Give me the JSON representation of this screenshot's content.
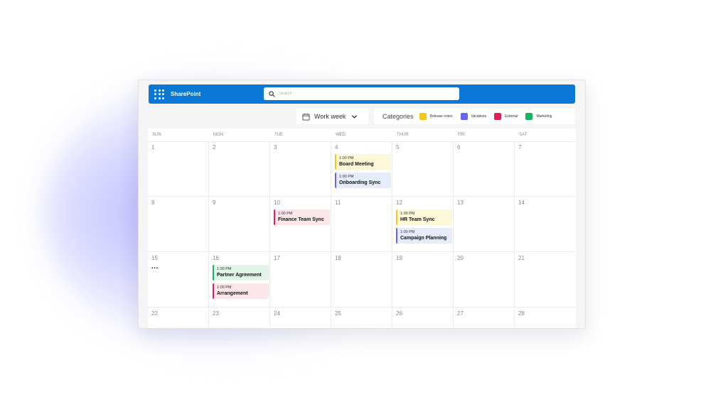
{
  "app": {
    "name": "SharePoint"
  },
  "search": {
    "placeholder": "Search"
  },
  "view": {
    "selected": "Work week"
  },
  "categories": {
    "title": "Categories",
    "items": [
      {
        "name": "Release notes",
        "color": "#f5c518"
      },
      {
        "name": "Vacations",
        "color": "#6366f1"
      },
      {
        "name": "External",
        "color": "#e11d58"
      },
      {
        "name": "Marketing",
        "color": "#16b364"
      }
    ]
  },
  "calendar": {
    "days_of_week": [
      "SUN",
      "MON",
      "TUE",
      "WED",
      "THUR",
      "FRI",
      "SAT"
    ],
    "weeks": [
      [
        "1",
        "2",
        "3",
        "4",
        "5",
        "6",
        "7"
      ],
      [
        "8",
        "9",
        "10",
        "11",
        "12",
        "13",
        "14"
      ],
      [
        "15",
        "16",
        "17",
        "18",
        "19",
        "20",
        "21"
      ],
      [
        "22",
        "23",
        "24",
        "25",
        "26",
        "27",
        "28"
      ]
    ],
    "events": [
      {
        "week": 0,
        "day": 3,
        "time": "1:00 PM",
        "title": "Board Meeting",
        "bg": "#fdf8d8",
        "accent": "#f5c518"
      },
      {
        "week": 0,
        "day": 3,
        "time": "1:00 PM",
        "title": "Onboarding Sync",
        "bg": "#e6ecfb",
        "accent": "#6366f1"
      },
      {
        "week": 1,
        "day": 2,
        "time": "1:00 PM",
        "title": "Finance Team Sync",
        "bg": "#fde6ea",
        "accent": "#e11d58"
      },
      {
        "week": 1,
        "day": 4,
        "time": "1:00 PM",
        "title": "HR Team Sync",
        "bg": "#fdf8d8",
        "accent": "#f5c518"
      },
      {
        "week": 1,
        "day": 4,
        "time": "1:00 PM",
        "title": "Campaign Planning",
        "bg": "#e6ecfb",
        "accent": "#6366f1"
      },
      {
        "week": 2,
        "day": 1,
        "time": "1:00 PM",
        "title": "Partner Agreement",
        "bg": "#e2f4e8",
        "accent": "#16b364"
      },
      {
        "week": 2,
        "day": 1,
        "time": "1:00 PM",
        "title": "Arrangement",
        "bg": "#fde6ea",
        "accent": "#e11d58"
      }
    ],
    "more_indicator": {
      "week": 2,
      "day": 0,
      "text": "..."
    }
  }
}
